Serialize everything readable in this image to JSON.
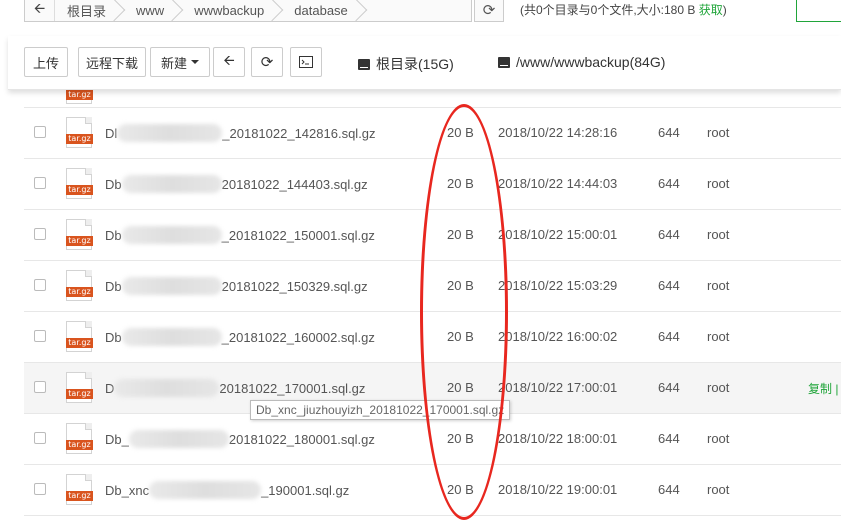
{
  "path_bar": {
    "back_icon": "arrow-left-icon",
    "crumbs": [
      "根目录",
      "www",
      "wwwbackup",
      "database"
    ],
    "refresh_icon": "refresh-icon",
    "dir_info": "(共0个目录与0个文件,大小:180 B ",
    "fetch_label": "获取",
    "dir_info_close": ")"
  },
  "toolbar": {
    "upload": "上传",
    "remote_download": "远程下载",
    "new": "新建",
    "back_icon": "arrow-left-icon",
    "refresh_icon": "refresh-icon",
    "terminal_icon": "terminal-icon",
    "disks": [
      {
        "label": "根目录(15G)",
        "icon": "hdd-icon"
      },
      {
        "label": "/www/wwwbackup(84G)",
        "icon": "hdd-icon"
      }
    ]
  },
  "file_icon_tag": "tar.gz",
  "files": [
    {
      "name_prefix": "Dl",
      "name_suffix": "_20181022_142816.sql.gz",
      "size": "20 B",
      "mtime": "2018/10/22 14:28:16",
      "perm": "644",
      "owner": "root"
    },
    {
      "name_prefix": "Db",
      "name_suffix": "20181022_144403.sql.gz",
      "size": "20 B",
      "mtime": "2018/10/22 14:44:03",
      "perm": "644",
      "owner": "root"
    },
    {
      "name_prefix": "Db",
      "name_suffix": "_20181022_150001.sql.gz",
      "size": "20 B",
      "mtime": "2018/10/22 15:00:01",
      "perm": "644",
      "owner": "root"
    },
    {
      "name_prefix": "Db",
      "name_suffix": "20181022_150329.sql.gz",
      "size": "20 B",
      "mtime": "2018/10/22 15:03:29",
      "perm": "644",
      "owner": "root"
    },
    {
      "name_prefix": "Db",
      "name_suffix": "_20181022_160002.sql.gz",
      "size": "20 B",
      "mtime": "2018/10/22 16:00:02",
      "perm": "644",
      "owner": "root"
    },
    {
      "name_prefix": "D",
      "name_suffix": "20181022_170001.sql.gz",
      "size": "20 B",
      "mtime": "2018/10/22 17:00:01",
      "perm": "644",
      "owner": "root",
      "op_label": "复制 |"
    },
    {
      "name_prefix": "Db_",
      "name_suffix": "20181022_180001.sql.gz",
      "size": "20 B",
      "mtime": "2018/10/22 18:00:01",
      "perm": "644",
      "owner": "root"
    },
    {
      "name_prefix": "Db_xnc",
      "name_suffix": "_190001.sql.gz",
      "size": "20 B",
      "mtime": "2018/10/22 19:00:01",
      "perm": "644",
      "owner": "root"
    }
  ],
  "tooltip": "Db_xnc_jiuzhouyizh_20181022_170001.sql.gz",
  "annotation_color": "#e8271f"
}
